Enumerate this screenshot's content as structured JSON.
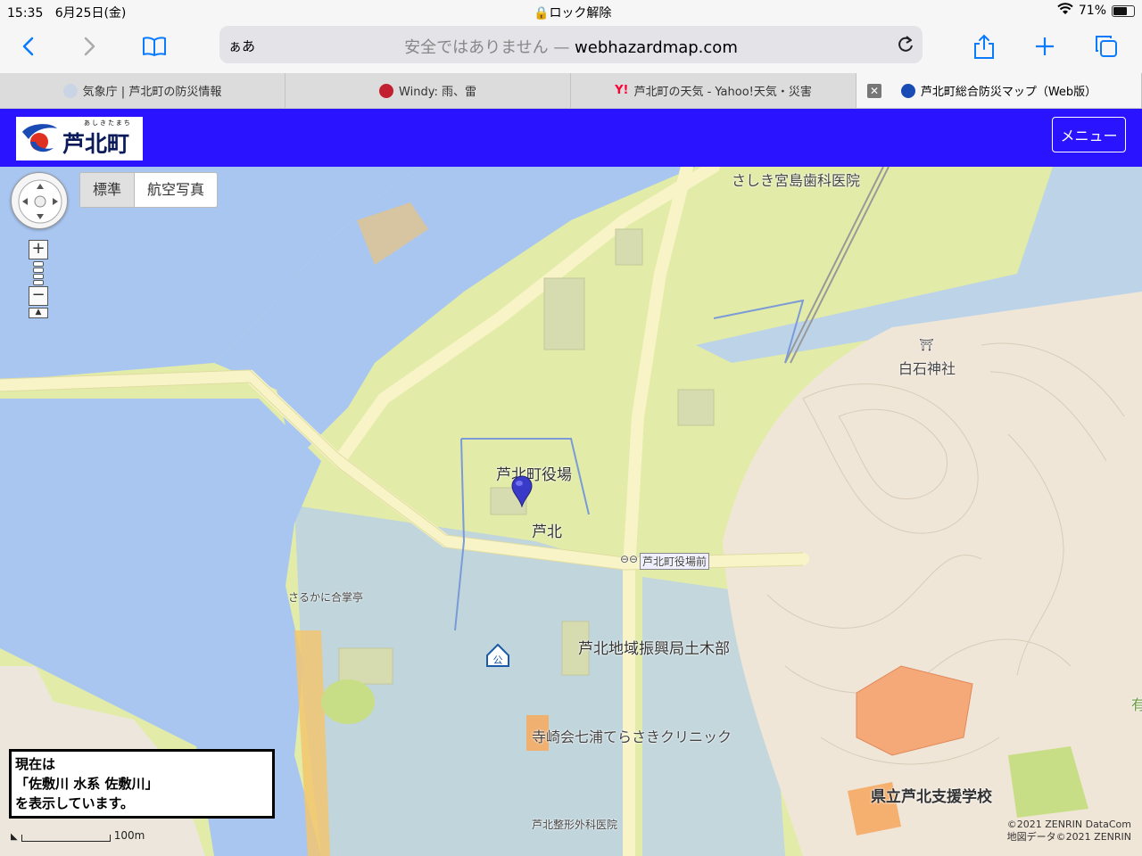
{
  "status_bar": {
    "time": "15:35",
    "date": "6月25日(金)",
    "lock_text": "ロック解除",
    "battery_percent": "71%",
    "battery_level": 0.71
  },
  "address_bar": {
    "text_size_label": "ぁあ",
    "security_text": "安全ではありません — ",
    "domain": "webhazardmap.com"
  },
  "tabs": [
    {
      "label": "気象庁 | 芦北町の防災情報",
      "icon": "jma-icon",
      "active": false
    },
    {
      "label": "Windy: 雨、雷",
      "icon": "windy-icon",
      "active": false
    },
    {
      "label": "芦北町の天気 - Yahoo!天気・災害",
      "icon": "yahoo-icon",
      "active": false
    },
    {
      "label": "芦北町総合防災マップ（Web版）",
      "icon": "ashikita-icon",
      "active": true
    }
  ],
  "site_header": {
    "logo_ruby": "あしきたまち",
    "logo_name": "芦北町",
    "menu_label": "メニュー",
    "header_color": "#2a14ff"
  },
  "map_controls": {
    "map_type_standard": "標準",
    "map_type_aerial": "航空写真",
    "zoom_in": "+",
    "zoom_out": "−"
  },
  "map_labels": {
    "dental": "さしき宮島歯科医院",
    "shrine": "白石神社",
    "town_office": "芦北町役場",
    "district": "芦北",
    "bus_stop": "芦北町役場前",
    "sarukani": "さるかに合掌亭",
    "civil_eng": "芦北地域振興局土木部",
    "clinic": "寺崎会七浦てらさきクリニック",
    "school": "県立芦北支援学校",
    "ortho": "芦北整形外科医院",
    "edge_char": "有"
  },
  "info_box": {
    "line1": "現在は",
    "line2": "「佐敷川 水系 佐敷川」",
    "line3": "を表示しています。"
  },
  "scale": {
    "label": "100m"
  },
  "copyright": {
    "line1": "©2021 ZENRIN DataCom",
    "line2": "地図データ©2021 ZENRIN"
  },
  "colors": {
    "water": "#a9c6f0",
    "flood_yellow": "#e4ee9a",
    "flood_orange": "#f5c46a",
    "hill": "#f0e6d8"
  }
}
